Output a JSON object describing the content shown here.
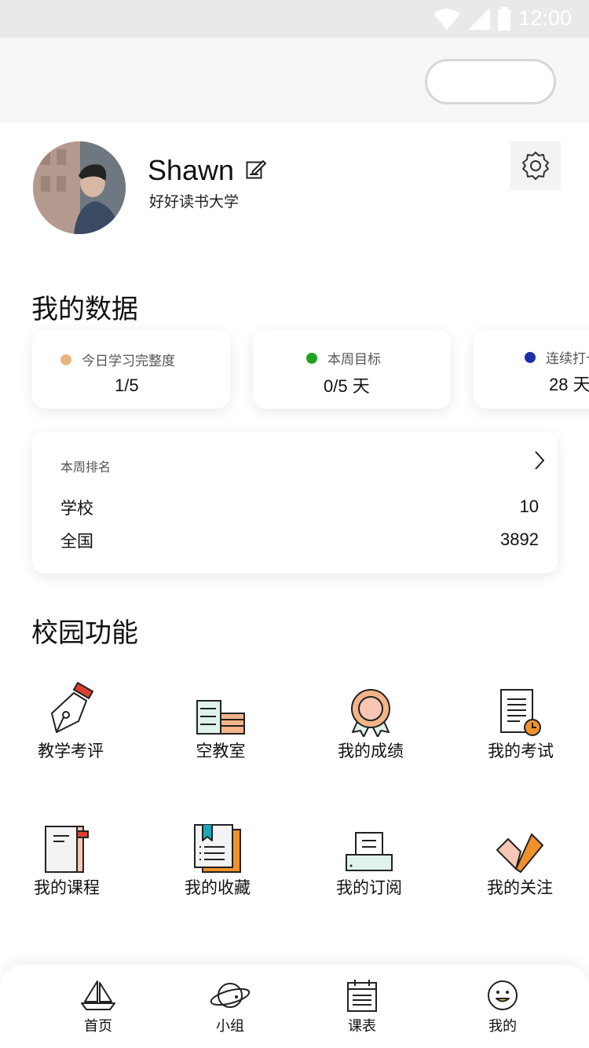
{
  "status_bar": {
    "time": "12:00",
    "icons": [
      "wifi-icon",
      "signal-icon",
      "battery-icon"
    ]
  },
  "profile": {
    "name": "Shawn",
    "school": "好好读书大学"
  },
  "my_data": {
    "title": "我的数据",
    "stats": [
      {
        "label": "今日学习完整度",
        "value": "1/5",
        "color": "#e9b57e"
      },
      {
        "label": "本周目标",
        "value": "0/5 天",
        "color": "#1fa31f"
      },
      {
        "label": "连续打卡",
        "value": "28 天",
        "color": "#1a2ea8"
      }
    ]
  },
  "ranking": {
    "title": "本周排名",
    "rows": [
      {
        "label": "学校",
        "value": "10"
      },
      {
        "label": "全国",
        "value": "3892"
      }
    ]
  },
  "campus": {
    "title": "校园功能",
    "items": [
      {
        "label": "教学考评",
        "icon": "pen-nib-icon"
      },
      {
        "label": "空教室",
        "icon": "classroom-icon"
      },
      {
        "label": "我的成绩",
        "icon": "medal-icon"
      },
      {
        "label": "我的考试",
        "icon": "exam-icon"
      },
      {
        "label": "我的课程",
        "icon": "notebook-icon"
      },
      {
        "label": "我的收藏",
        "icon": "bookmark-icon"
      },
      {
        "label": "我的订阅",
        "icon": "printer-icon"
      },
      {
        "label": "我的关注",
        "icon": "heart-icon"
      }
    ]
  },
  "tabs": [
    {
      "label": "首页",
      "icon": "sailboat-icon"
    },
    {
      "label": "小组",
      "icon": "planet-icon"
    },
    {
      "label": "课表",
      "icon": "calendar-icon"
    },
    {
      "label": "我的",
      "icon": "smiley-icon"
    }
  ],
  "colors": {
    "orange": "#f0922c",
    "peach": "#f4b48a",
    "red": "#d9412f",
    "teal": "#1ea7b8",
    "mint": "#dff3ea"
  }
}
